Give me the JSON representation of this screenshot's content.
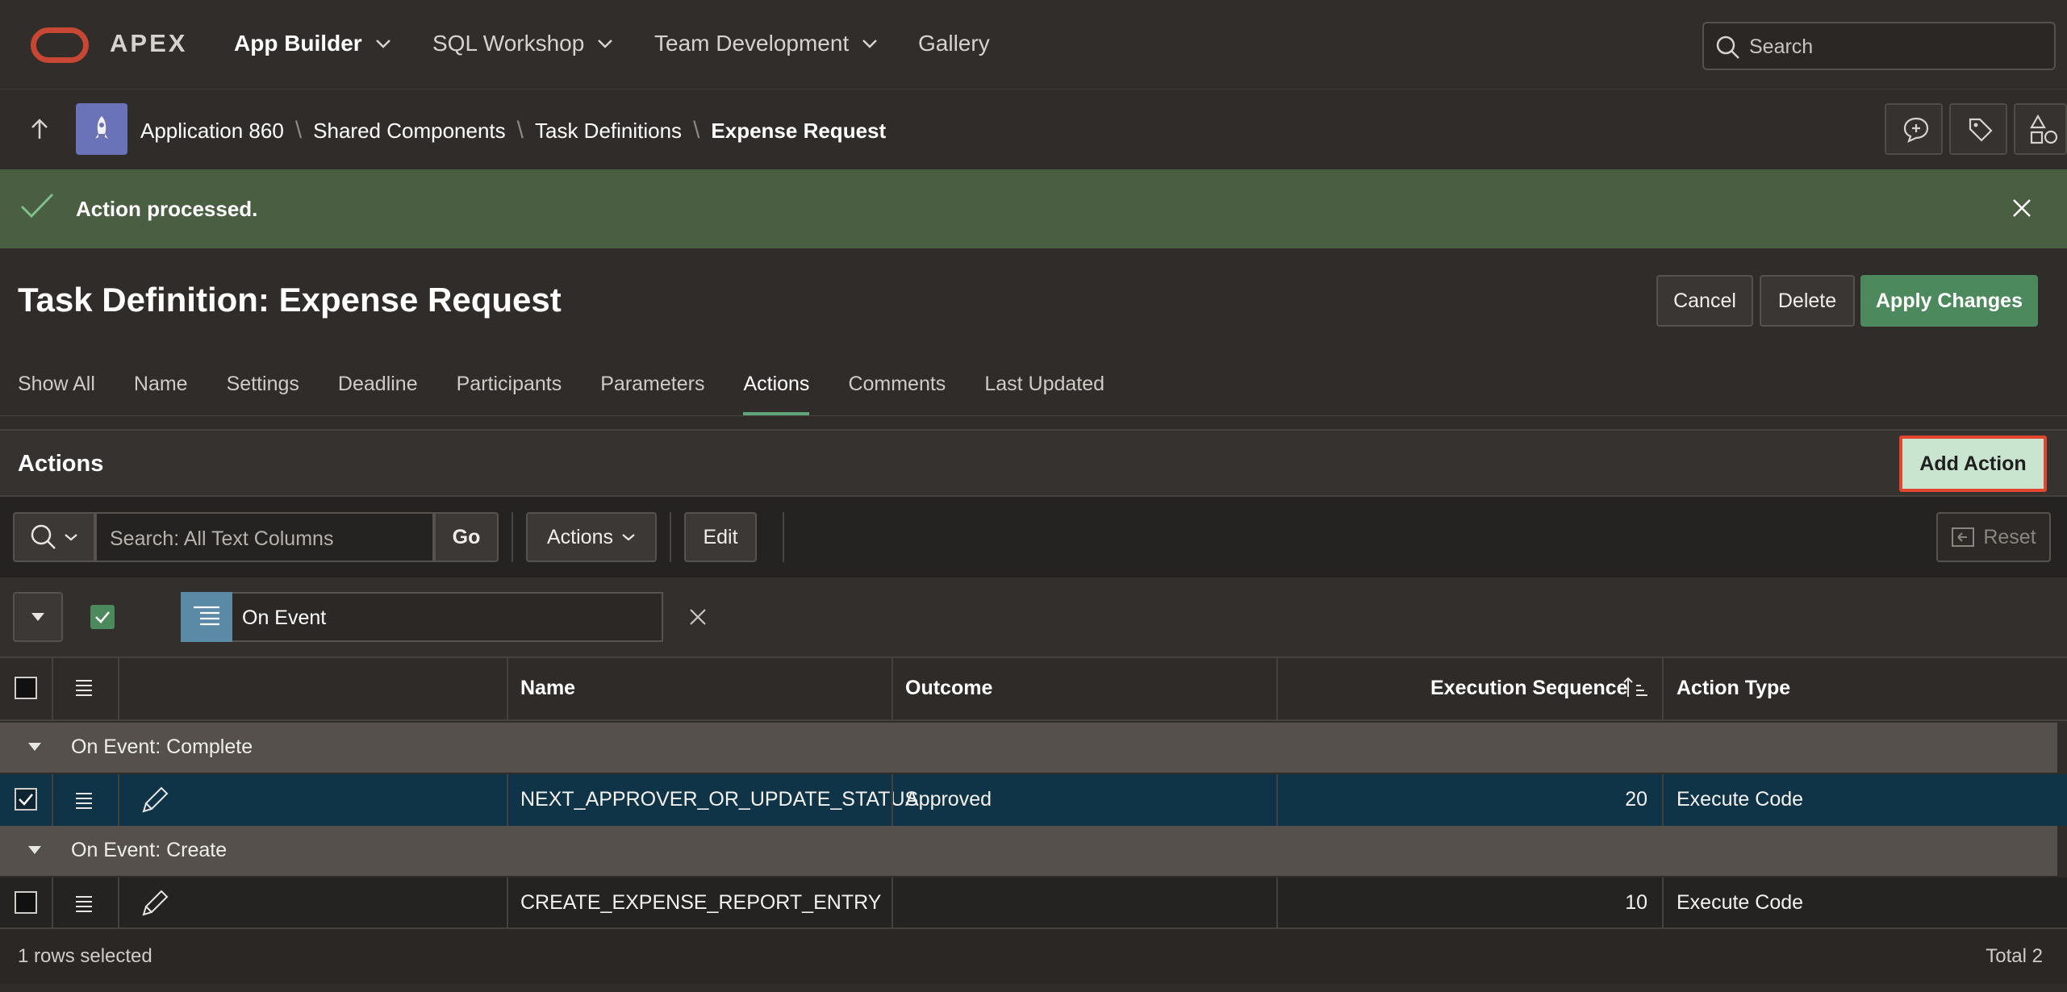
{
  "header": {
    "brand": "APEX",
    "nav": [
      {
        "label": "App Builder",
        "has_menu": true,
        "active": true
      },
      {
        "label": "SQL Workshop",
        "has_menu": true
      },
      {
        "label": "Team Development",
        "has_menu": true
      },
      {
        "label": "Gallery",
        "has_menu": false
      }
    ],
    "search_placeholder": "Search"
  },
  "breadcrumb": {
    "items": [
      "Application 860",
      "Shared Components",
      "Task Definitions"
    ],
    "current": "Expense Request"
  },
  "alert": {
    "message": "Action processed.",
    "color": "#4a5e42"
  },
  "page": {
    "title": "Task Definition: Expense Request",
    "buttons": {
      "cancel": "Cancel",
      "delete": "Delete",
      "apply": "Apply Changes"
    }
  },
  "tabs": [
    "Show All",
    "Name",
    "Settings",
    "Deadline",
    "Participants",
    "Parameters",
    "Actions",
    "Comments",
    "Last Updated"
  ],
  "active_tab": "Actions",
  "region": {
    "title": "Actions",
    "add_button": "Add Action",
    "toolbar": {
      "search_placeholder": "Search: All Text Columns",
      "go": "Go",
      "actions": "Actions",
      "edit": "Edit",
      "reset": "Reset"
    },
    "control_break": {
      "label": "On Event"
    },
    "columns": {
      "name": "Name",
      "outcome": "Outcome",
      "sequence": "Execution Sequence",
      "type": "Action Type"
    },
    "groups": [
      {
        "label": "On Event: Complete",
        "rows": [
          {
            "name": "NEXT_APPROVER_OR_UPDATE_STATUS",
            "outcome": "Approved",
            "sequence": "20",
            "type": "Execute Code",
            "selected": true
          }
        ]
      },
      {
        "label": "On Event: Create",
        "rows": [
          {
            "name": "CREATE_EXPENSE_REPORT_ENTRY",
            "outcome": "",
            "sequence": "10",
            "type": "Execute Code",
            "selected": false
          }
        ]
      }
    ],
    "footer": {
      "selected": "1 rows selected",
      "total": "Total 2"
    }
  },
  "colors": {
    "accent_green": "#4c8a5e",
    "oracle_red": "#c74634",
    "highlight_border": "#e2462e"
  }
}
